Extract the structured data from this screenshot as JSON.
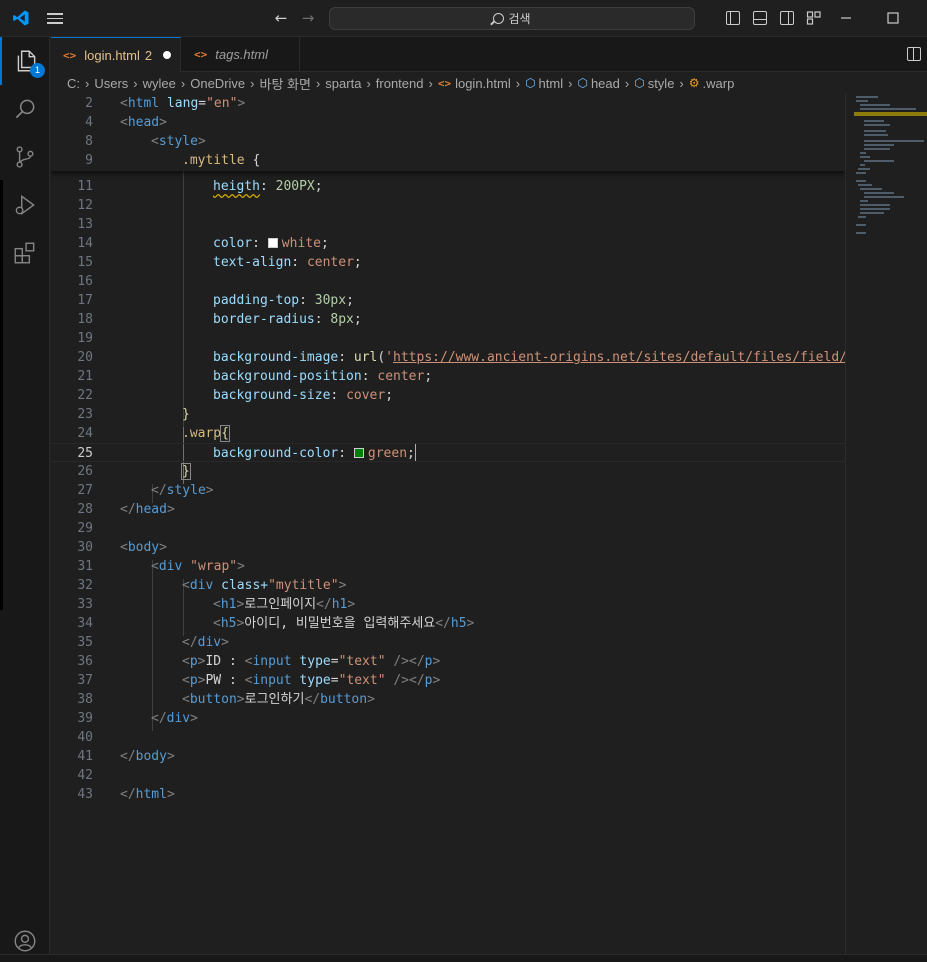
{
  "titlebar": {
    "search_label": "검색"
  },
  "activity": {
    "explorer_badge": "1"
  },
  "tabs": [
    {
      "label": "login.html",
      "problems": "2"
    },
    {
      "label": "tags.html"
    }
  ],
  "breadcrumb": [
    "C:",
    "Users",
    "wylee",
    "OneDrive",
    "바탕 화면",
    "sparta",
    "frontend",
    "login.html",
    "html",
    "head",
    "style",
    ".warp"
  ],
  "sticky_lines": [
    {
      "n": "2",
      "text": "<html lang=\"en\">"
    },
    {
      "n": "4",
      "text": "<head>"
    },
    {
      "n": "8",
      "text": "<style>"
    },
    {
      "n": "9",
      "text": ".mytitle {"
    }
  ],
  "code_lines": [
    {
      "n": "11",
      "text": "heigth: 200PX;"
    },
    {
      "n": "12",
      "text": ""
    },
    {
      "n": "13",
      "text": ""
    },
    {
      "n": "14",
      "text": "color: white;"
    },
    {
      "n": "15",
      "text": "text-align: center;"
    },
    {
      "n": "16",
      "text": ""
    },
    {
      "n": "17",
      "text": "padding-top: 30px;"
    },
    {
      "n": "18",
      "text": "border-radius: 8px;"
    },
    {
      "n": "19",
      "text": ""
    },
    {
      "n": "20",
      "text": "background-image: url('https://www.ancient-origins.net/sites/default/files/field/im"
    },
    {
      "n": "21",
      "text": "background-position: center;"
    },
    {
      "n": "22",
      "text": "background-size: cover;"
    },
    {
      "n": "23",
      "text": "}"
    },
    {
      "n": "24",
      "text": ".warp{"
    },
    {
      "n": "25",
      "text": "background-color: green;"
    },
    {
      "n": "26",
      "text": "}"
    },
    {
      "n": "27",
      "text": "</style>"
    },
    {
      "n": "28",
      "text": "</head>"
    },
    {
      "n": "29",
      "text": ""
    },
    {
      "n": "30",
      "text": "<body>"
    },
    {
      "n": "31",
      "text": "<div \"wrap\">"
    },
    {
      "n": "32",
      "text": "<div class+\"mytitle\">"
    },
    {
      "n": "33",
      "text": "<h1>로그인페이지</h1>"
    },
    {
      "n": "34",
      "text": "<h5>아이디, 비밀번호을 입력해주세요</h5>"
    },
    {
      "n": "35",
      "text": "</div>"
    },
    {
      "n": "36",
      "text": "<p>ID : <input type=\"text\" /></p>"
    },
    {
      "n": "37",
      "text": "<p>PW : <input type=\"text\" /></p>"
    },
    {
      "n": "38",
      "text": "<button>로그인하기</button>"
    },
    {
      "n": "39",
      "text": "</div>"
    },
    {
      "n": "40",
      "text": ""
    },
    {
      "n": "41",
      "text": "</body>"
    },
    {
      "n": "42",
      "text": ""
    },
    {
      "n": "43",
      "text": "</html>"
    }
  ],
  "tokens": {
    "lang_attr": "lang",
    "lang_val": "\"en\"",
    "class_kw": "class+",
    "type_attr": "type",
    "url_fn": "url",
    "url_str": "https://www.ancient-origins.net/sites/default/files/field/im",
    "colors": {
      "white": "#ffffff",
      "green": "#008000",
      "accent": "#0078d4"
    }
  }
}
